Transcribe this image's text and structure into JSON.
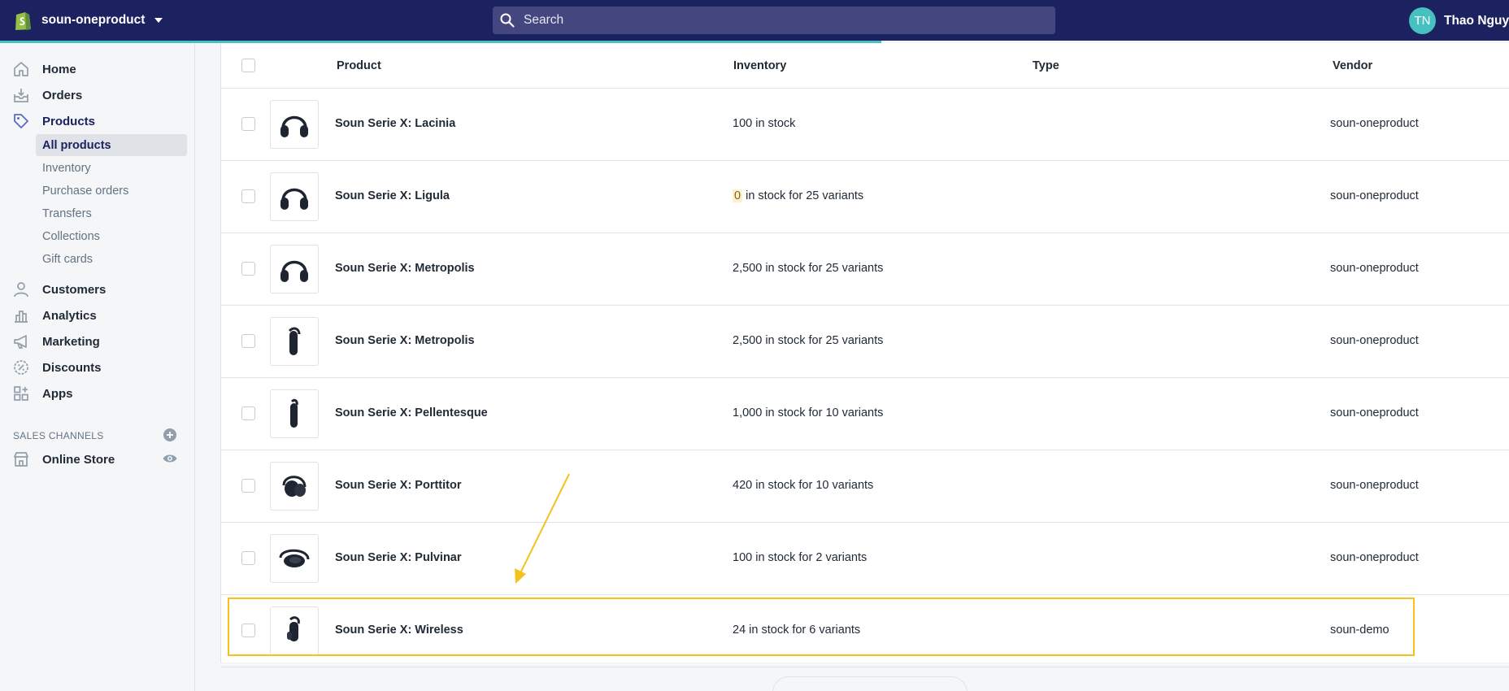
{
  "topbar": {
    "store_name": "soun-oneproduct",
    "search_placeholder": "Search",
    "user_initials": "TN",
    "user_name": "Thao Nguyễn",
    "load_progress": 0.584
  },
  "sidebar": {
    "items": [
      {
        "label": "Home",
        "icon": "home-icon"
      },
      {
        "label": "Orders",
        "icon": "orders-icon"
      },
      {
        "label": "Products",
        "icon": "tag-icon"
      },
      {
        "label": "Customers",
        "icon": "person-icon"
      },
      {
        "label": "Analytics",
        "icon": "bar-chart-icon"
      },
      {
        "label": "Marketing",
        "icon": "megaphone-icon"
      },
      {
        "label": "Discounts",
        "icon": "discount-icon"
      },
      {
        "label": "Apps",
        "icon": "apps-icon"
      }
    ],
    "product_subitems": [
      "All products",
      "Inventory",
      "Purchase orders",
      "Transfers",
      "Collections",
      "Gift cards"
    ],
    "sales_channels_title": "SALES CHANNELS",
    "online_store": "Online Store"
  },
  "table": {
    "headers": {
      "product": "Product",
      "inventory": "Inventory",
      "type": "Type",
      "vendor": "Vendor"
    },
    "rows": [
      {
        "name": "Soun Serie X: Lacinia",
        "inventory": "100 in stock",
        "type": "",
        "vendor": "soun-oneproduct"
      },
      {
        "name": "Soun Serie X: Ligula",
        "inventory_zero": "0",
        "inventory": " in stock for 25 variants",
        "type": "",
        "vendor": "soun-oneproduct"
      },
      {
        "name": "Soun Serie X: Metropolis",
        "inventory": "2,500 in stock for 25 variants",
        "type": "",
        "vendor": "soun-oneproduct"
      },
      {
        "name": "Soun Serie X: Metropolis",
        "inventory": "2,500 in stock for 25 variants",
        "type": "",
        "vendor": "soun-oneproduct"
      },
      {
        "name": "Soun Serie X: Pellentesque",
        "inventory": "1,000 in stock for 10 variants",
        "type": "",
        "vendor": "soun-oneproduct"
      },
      {
        "name": "Soun Serie X: Porttitor",
        "inventory": "420 in stock for 10 variants",
        "type": "",
        "vendor": "soun-oneproduct"
      },
      {
        "name": "Soun Serie X: Pulvinar",
        "inventory": "100 in stock for 2 variants",
        "type": "",
        "vendor": "soun-oneproduct"
      },
      {
        "name": "Soun Serie X: Wireless",
        "inventory": "24 in stock for 6 variants",
        "type": "",
        "vendor": "soun-demo"
      }
    ]
  },
  "colors": {
    "topbar": "#1c2260",
    "progress": "#47c1bf",
    "highlight": "#f5c21b",
    "zero_stock_bg": "#fcf1cd"
  }
}
